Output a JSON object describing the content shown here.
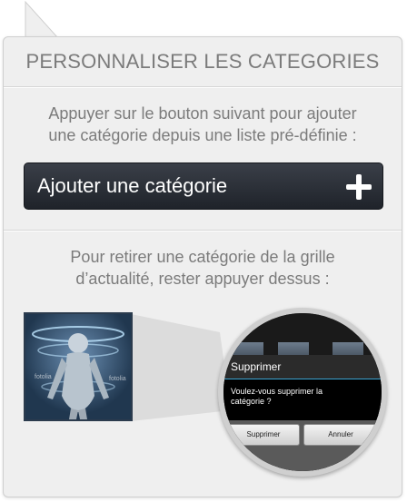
{
  "title": "PERSONNALISER LES CATEGORIES",
  "add_instruction": {
    "line1": "Appuyer sur le bouton suivant pour ajouter",
    "line2": "une catégorie depuis une liste pré-définie :"
  },
  "add_button": {
    "label": "Ajouter une catégorie",
    "icon": "plus-icon"
  },
  "remove_instruction": {
    "line1": "Pour retirer une catégorie de la grille",
    "line2": "d’actualité, rester appuyer dessus :"
  },
  "thumbnail": {
    "watermark": "fotolia"
  },
  "dialog": {
    "title": "Supprimer",
    "message": "Voulez-vous supprimer la catégorie ?",
    "confirm_label": "Supprimer",
    "cancel_label": "Annuler"
  },
  "colors": {
    "panel": "#efefef",
    "text": "#7b7b7b",
    "button": "#2a2f37",
    "dialog_accent": "#3da7d6"
  }
}
